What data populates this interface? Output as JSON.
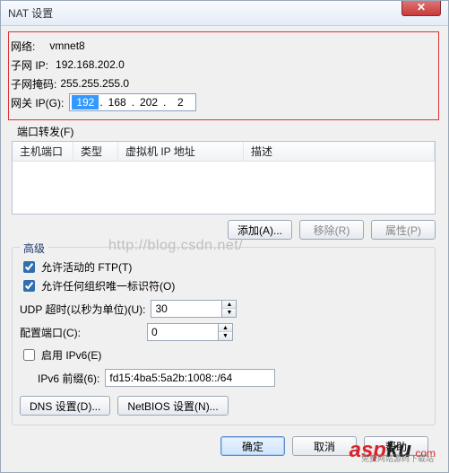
{
  "title": "NAT 设置",
  "close_glyph": "✕",
  "network": {
    "label": "网络:",
    "value": "vmnet8",
    "subnet_ip_label": "子网 IP:",
    "subnet_ip_value": "192.168.202.0",
    "subnet_mask_label": "子网掩码:",
    "subnet_mask_value": "255.255.255.0",
    "gateway_label": "网关 IP(G):",
    "gateway_seg1": "192",
    "gateway_seg2": "168",
    "gateway_seg3": "202",
    "gateway_seg4": "2"
  },
  "port_forward_label": "端口转发(F)",
  "table": {
    "col_host_port": "主机端口",
    "col_type": "类型",
    "col_vm_ip": "虚拟机 IP 地址",
    "col_desc": "描述"
  },
  "buttons": {
    "add": "添加(A)...",
    "remove": "移除(R)",
    "properties": "属性(P)",
    "dns": "DNS 设置(D)...",
    "netbios": "NetBIOS 设置(N)...",
    "ok": "确定",
    "cancel": "取消",
    "help": "帮助"
  },
  "advanced": {
    "legend": "高级",
    "allow_active_ftp": "允许活动的 FTP(T)",
    "allow_any_oid": "允许任何组织唯一标识符(O)",
    "udp_timeout_label": "UDP 超时(以秒为单位)(U):",
    "udp_timeout_value": "30",
    "config_port_label": "配置端口(C):",
    "config_port_value": "0",
    "enable_ipv6": "启用 IPv6(E)",
    "ipv6_prefix_label": "IPv6 前缀(6):",
    "ipv6_prefix_value": "fd15:4ba5:5a2b:1008::/64"
  },
  "watermark": "http://blog.csdn.net/",
  "logo": {
    "a": "asp",
    "k": "ku",
    "c": ".com",
    "sub": "免费网站源码下载站"
  }
}
